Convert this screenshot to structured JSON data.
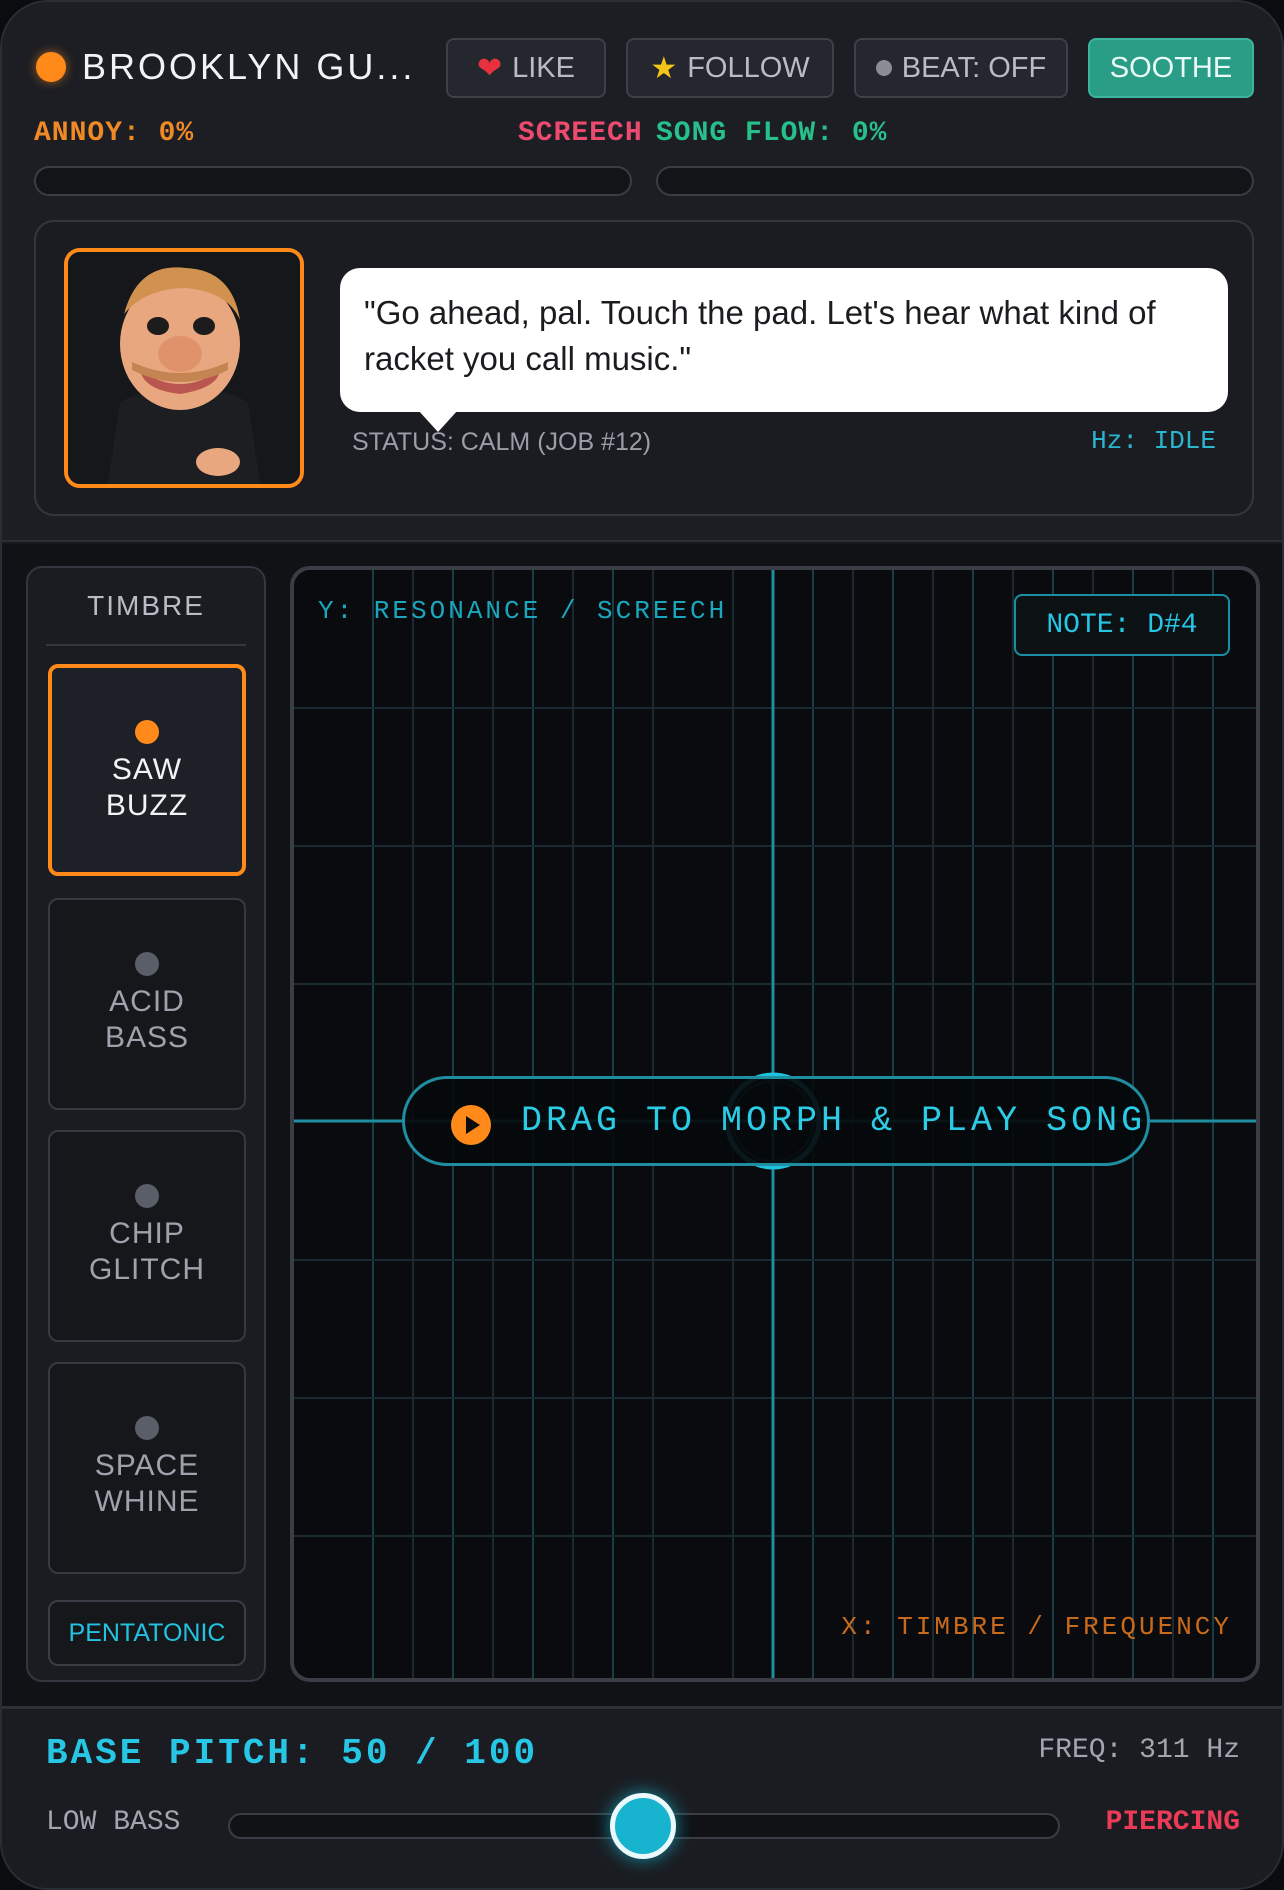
{
  "header": {
    "title": "BROOKLYN GU...",
    "like_label": "LIKE",
    "follow_label": "FOLLOW",
    "beat_label": "BEAT: OFF",
    "soothe_label": "SOOTHE",
    "icons": {
      "like": "heart-icon",
      "follow": "star-icon"
    },
    "accent_color": "#ff8a1a",
    "soothe_color": "#2a9d87"
  },
  "meters": {
    "annoy_label": "ANNOY: 0%",
    "annoy_value": 0,
    "screech_label": "SCREECH",
    "flow_label": "SONG FLOW: 0%",
    "flow_value": 0
  },
  "character": {
    "speech": "\"Go ahead, pal. Touch the pad. Let's hear what kind of racket you call music.\"",
    "status": "STATUS: CALM (JOB #12)",
    "hz": "Hz: IDLE"
  },
  "timbre": {
    "title": "TIMBRE",
    "options": [
      {
        "label": "SAW\nBUZZ",
        "active": true
      },
      {
        "label": "ACID\nBASS",
        "active": false
      },
      {
        "label": "CHIP\nGLITCH",
        "active": false
      },
      {
        "label": "SPACE\nWHINE",
        "active": false
      }
    ],
    "scale_label": "PENTATONIC"
  },
  "pad": {
    "y_label": "Y: RESONANCE / SCREECH",
    "x_label": "X: TIMBRE / FREQUENCY",
    "note": "NOTE: D#4",
    "play_label": "DRAG TO MORPH & PLAY SONG"
  },
  "pitch": {
    "title": "BASE PITCH: 50 / 100",
    "value": 50,
    "max": 100,
    "freq": "FREQ: 311 Hz",
    "low_label": "LOW BASS",
    "high_label": "PIERCING"
  }
}
